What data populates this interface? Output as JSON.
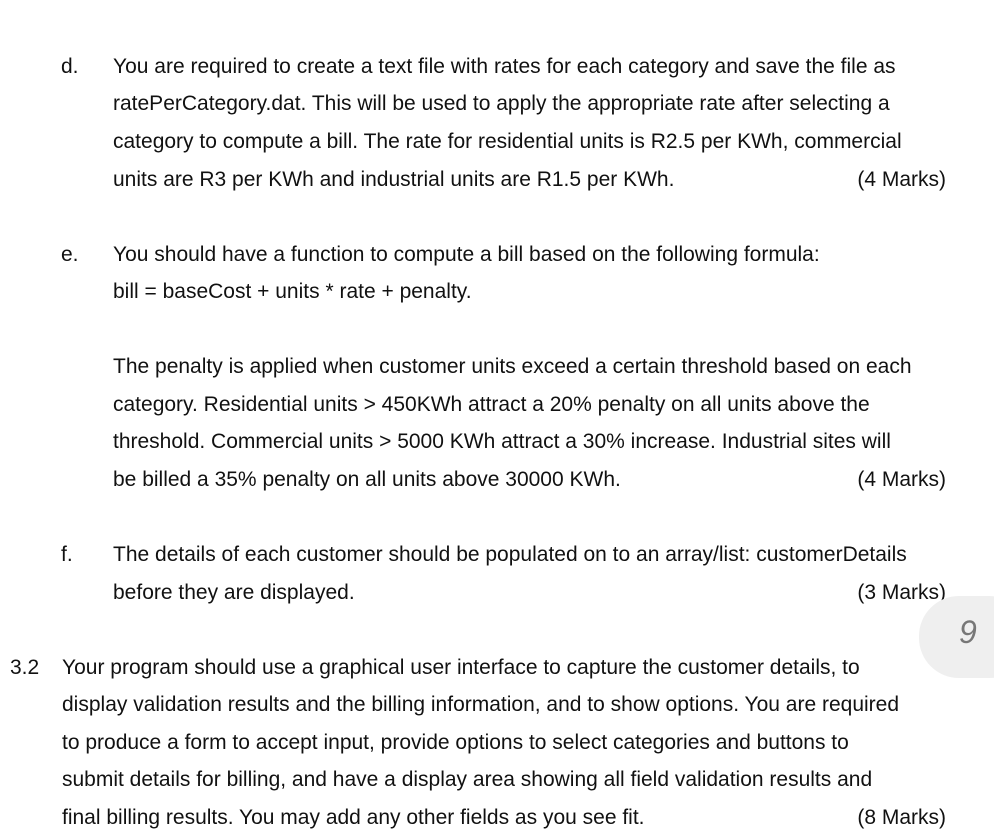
{
  "items": [
    {
      "label": "d.",
      "lines": [
        "You are required to create a text file with rates for each category and save the file as",
        "ratePerCategory.dat. This will be used to apply the appropriate rate after selecting a",
        "category to compute a bill. The rate for residential units is R2.5 per KWh, commercial",
        "units are R3 per KWh and industrial units are R1.5 per KWh."
      ],
      "marks": "(4 Marks)"
    },
    {
      "label": "e.",
      "lines": [
        "You should have a function to compute a bill based on the following formula:",
        "bill = baseCost + units * rate + penalty."
      ],
      "paragraph2": [
        "The penalty is applied when customer units exceed a certain threshold based on each",
        "category. Residential units > 450KWh attract a 20% penalty on all units above the",
        "threshold. Commercial units > 5000 KWh attract a 30% increase. Industrial sites will",
        "be billed a 35% penalty on all units above 30000 KWh."
      ],
      "marks": "(4 Marks)"
    },
    {
      "label": "f.",
      "lines": [
        "The details of each customer should be populated on to an array/list: customerDetails",
        "before they are displayed."
      ],
      "marks": "(3 Marks)"
    },
    {
      "label": "3.2",
      "lines": [
        "Your program should use a graphical user interface to capture the customer details, to",
        "display validation results and the billing information, and to show options. You are required",
        "to produce a form to accept input, provide options to select categories and buttons to",
        "submit details for billing, and have a display area showing all field validation results and",
        "final billing results. You may add any other fields as you see fit."
      ],
      "marks": "(8 Marks)"
    }
  ],
  "page_number": "9"
}
